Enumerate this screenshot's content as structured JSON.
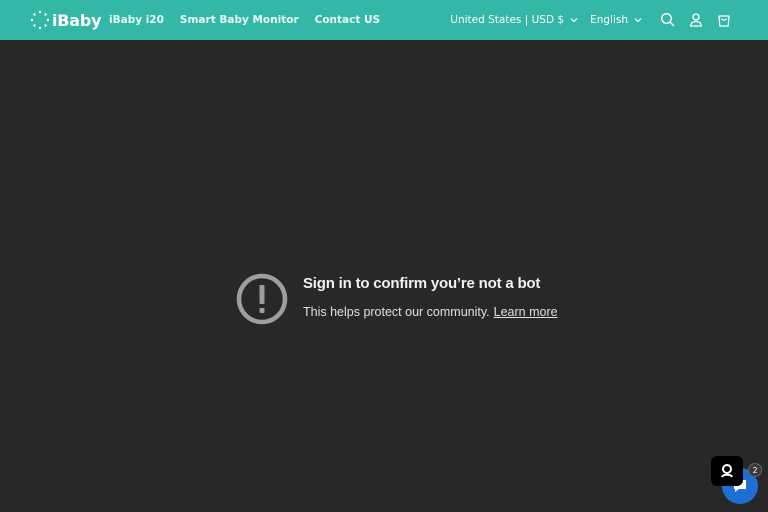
{
  "header": {
    "logo_text": "iBaby",
    "nav": [
      {
        "label": "iBaby i20"
      },
      {
        "label": "Smart Baby Monitor"
      },
      {
        "label": "Contact US"
      }
    ],
    "country_selector": "United States | USD $",
    "language_selector": "English",
    "icons": [
      "search-icon",
      "account-icon",
      "cart-icon"
    ],
    "brand_color": "#35b7a8"
  },
  "notice": {
    "title": "Sign in to confirm you’re not a bot",
    "description": "This helps protect our community.",
    "link_label": "Learn more",
    "icon": "alert-circle-icon"
  },
  "chat": {
    "badge_count": "2",
    "icon": "chat-icon",
    "accent": "#1f6ed4"
  }
}
